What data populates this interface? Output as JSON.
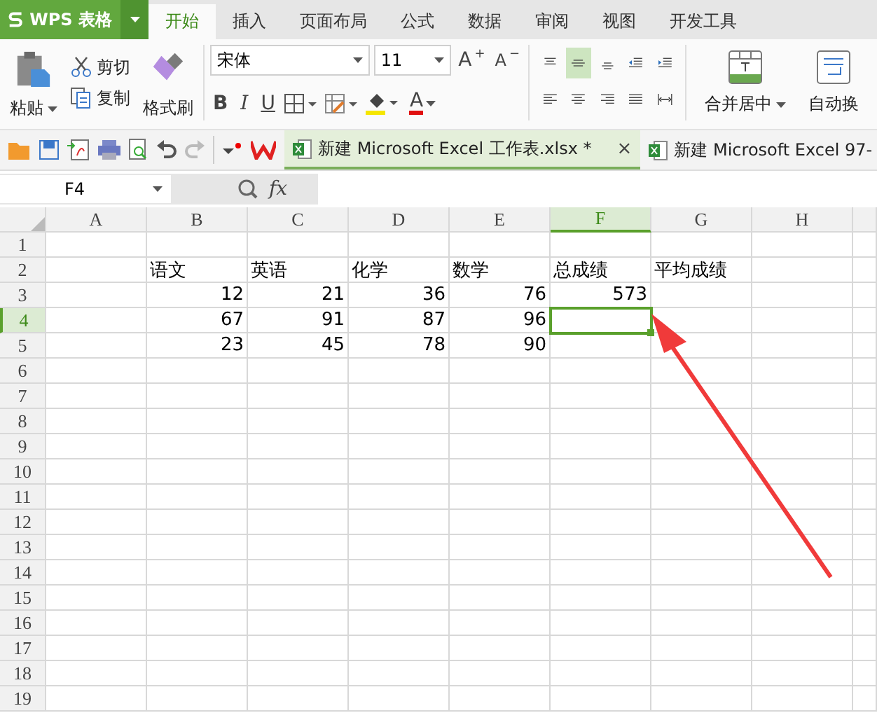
{
  "app_menu": {
    "label": "WPS 表格"
  },
  "tabs": [
    {
      "label": "开始",
      "selected": true
    },
    {
      "label": "插入",
      "selected": false
    },
    {
      "label": "页面布局",
      "selected": false
    },
    {
      "label": "公式",
      "selected": false
    },
    {
      "label": "数据",
      "selected": false
    },
    {
      "label": "审阅",
      "selected": false
    },
    {
      "label": "视图",
      "selected": false
    },
    {
      "label": "开发工具",
      "selected": false
    }
  ],
  "ribbon": {
    "clipboard": {
      "paste": "粘贴",
      "cut": "剪切",
      "copy": "复制",
      "format_painter": "格式刷"
    },
    "font": {
      "name": "宋体",
      "size": "11",
      "grow": "A",
      "grow_mark": "+",
      "shrink": "A",
      "shrink_mark": "−",
      "bold": "B",
      "italic": "I",
      "underline": "U",
      "color_button": "A"
    },
    "align_top": [
      {
        "kind": "top",
        "selected": false
      },
      {
        "kind": "middle",
        "selected": true
      },
      {
        "kind": "bottom",
        "selected": false
      },
      {
        "kind": "outdent",
        "selected": false
      },
      {
        "kind": "indent",
        "selected": false
      }
    ],
    "align_bottom": [
      {
        "kind": "left",
        "selected": false
      },
      {
        "kind": "center",
        "selected": false
      },
      {
        "kind": "right",
        "selected": false
      },
      {
        "kind": "justify",
        "selected": false
      },
      {
        "kind": "distribute",
        "selected": false
      }
    ],
    "merge": "合并居中",
    "wrap": "自动换"
  },
  "doc_tabs": [
    {
      "title": "新建 Microsoft Excel 工作表.xlsx *",
      "selected": true,
      "close": "×"
    },
    {
      "title": "新建 Microsoft Excel 97-",
      "selected": false
    }
  ],
  "formula_bar": {
    "name_box": "F4",
    "fx": "fx"
  },
  "sheet": {
    "columns": [
      {
        "label": "A",
        "selected": false
      },
      {
        "label": "B",
        "selected": false
      },
      {
        "label": "C",
        "selected": false
      },
      {
        "label": "D",
        "selected": false
      },
      {
        "label": "E",
        "selected": false
      },
      {
        "label": "F",
        "selected": true
      },
      {
        "label": "G",
        "selected": false
      },
      {
        "label": "H",
        "selected": false
      }
    ],
    "rows": [
      {
        "label": "1",
        "selected": false,
        "cells": []
      },
      {
        "label": "2",
        "selected": false,
        "kind": "text",
        "cells": [
          "",
          "语文",
          "英语",
          "化学",
          "数学",
          "总成绩",
          "平均成绩",
          ""
        ]
      },
      {
        "label": "3",
        "selected": false,
        "kind": "number",
        "cells": [
          "",
          "12",
          "21",
          "36",
          "76",
          "573",
          "",
          ""
        ]
      },
      {
        "label": "4",
        "selected": true,
        "kind": "number",
        "cells": [
          "",
          "67",
          "91",
          "87",
          "96",
          "",
          "",
          ""
        ]
      },
      {
        "label": "5",
        "selected": false,
        "kind": "number",
        "cells": [
          "",
          "23",
          "45",
          "78",
          "90",
          "",
          "",
          ""
        ]
      },
      {
        "label": "6",
        "selected": false,
        "cells": []
      },
      {
        "label": "7",
        "selected": false,
        "cells": []
      },
      {
        "label": "8",
        "selected": false,
        "cells": []
      },
      {
        "label": "9",
        "selected": false,
        "cells": []
      },
      {
        "label": "10",
        "selected": false,
        "cells": []
      },
      {
        "label": "11",
        "selected": false,
        "cells": []
      },
      {
        "label": "12",
        "selected": false,
        "cells": []
      },
      {
        "label": "13",
        "selected": false,
        "cells": []
      },
      {
        "label": "14",
        "selected": false,
        "cells": []
      },
      {
        "label": "15",
        "selected": false,
        "cells": []
      },
      {
        "label": "16",
        "selected": false,
        "cells": []
      },
      {
        "label": "17",
        "selected": false,
        "cells": []
      },
      {
        "label": "18",
        "selected": false,
        "cells": []
      },
      {
        "label": "19",
        "selected": false,
        "cells": []
      }
    ]
  }
}
